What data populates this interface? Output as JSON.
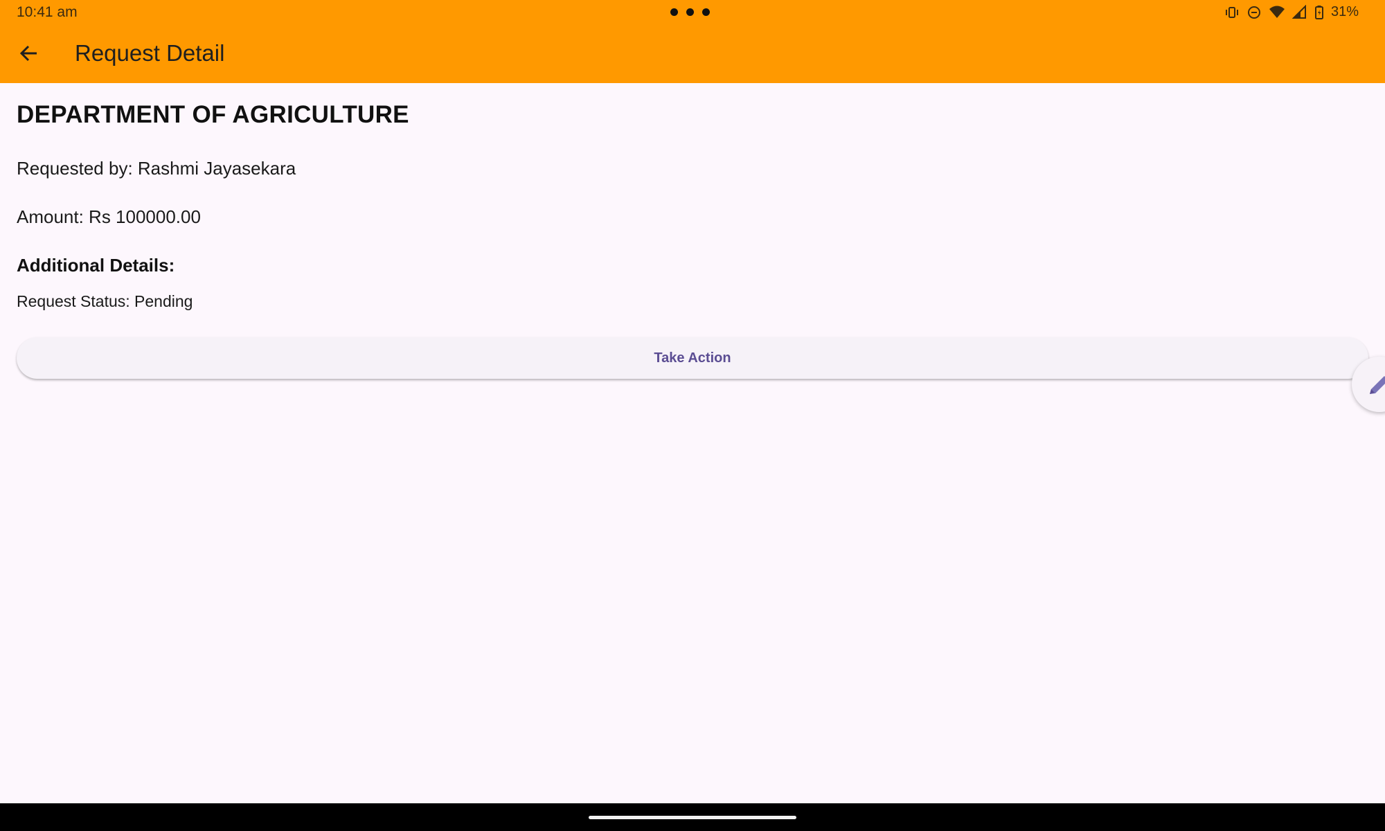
{
  "status_bar": {
    "time": "10:41 am",
    "battery": "31%",
    "icons": [
      "vibrate-icon",
      "do-not-disturb-icon",
      "wifi-icon",
      "signal-icon",
      "battery-icon"
    ]
  },
  "app_bar": {
    "title": "Request Detail",
    "back_icon": "arrow-back-icon",
    "color": "#ff9900"
  },
  "detail": {
    "department": "DEPARTMENT OF AGRICULTURE",
    "requested_by": "Requested by: Rashmi Jayasekara",
    "amount": "Amount: Rs 100000.00",
    "additional_heading": "Additional Details:",
    "status": "Request Status: Pending"
  },
  "actions": {
    "take_action": "Take Action",
    "fab_icon": "pencil-edit-icon",
    "accent": "#5b4d93"
  }
}
